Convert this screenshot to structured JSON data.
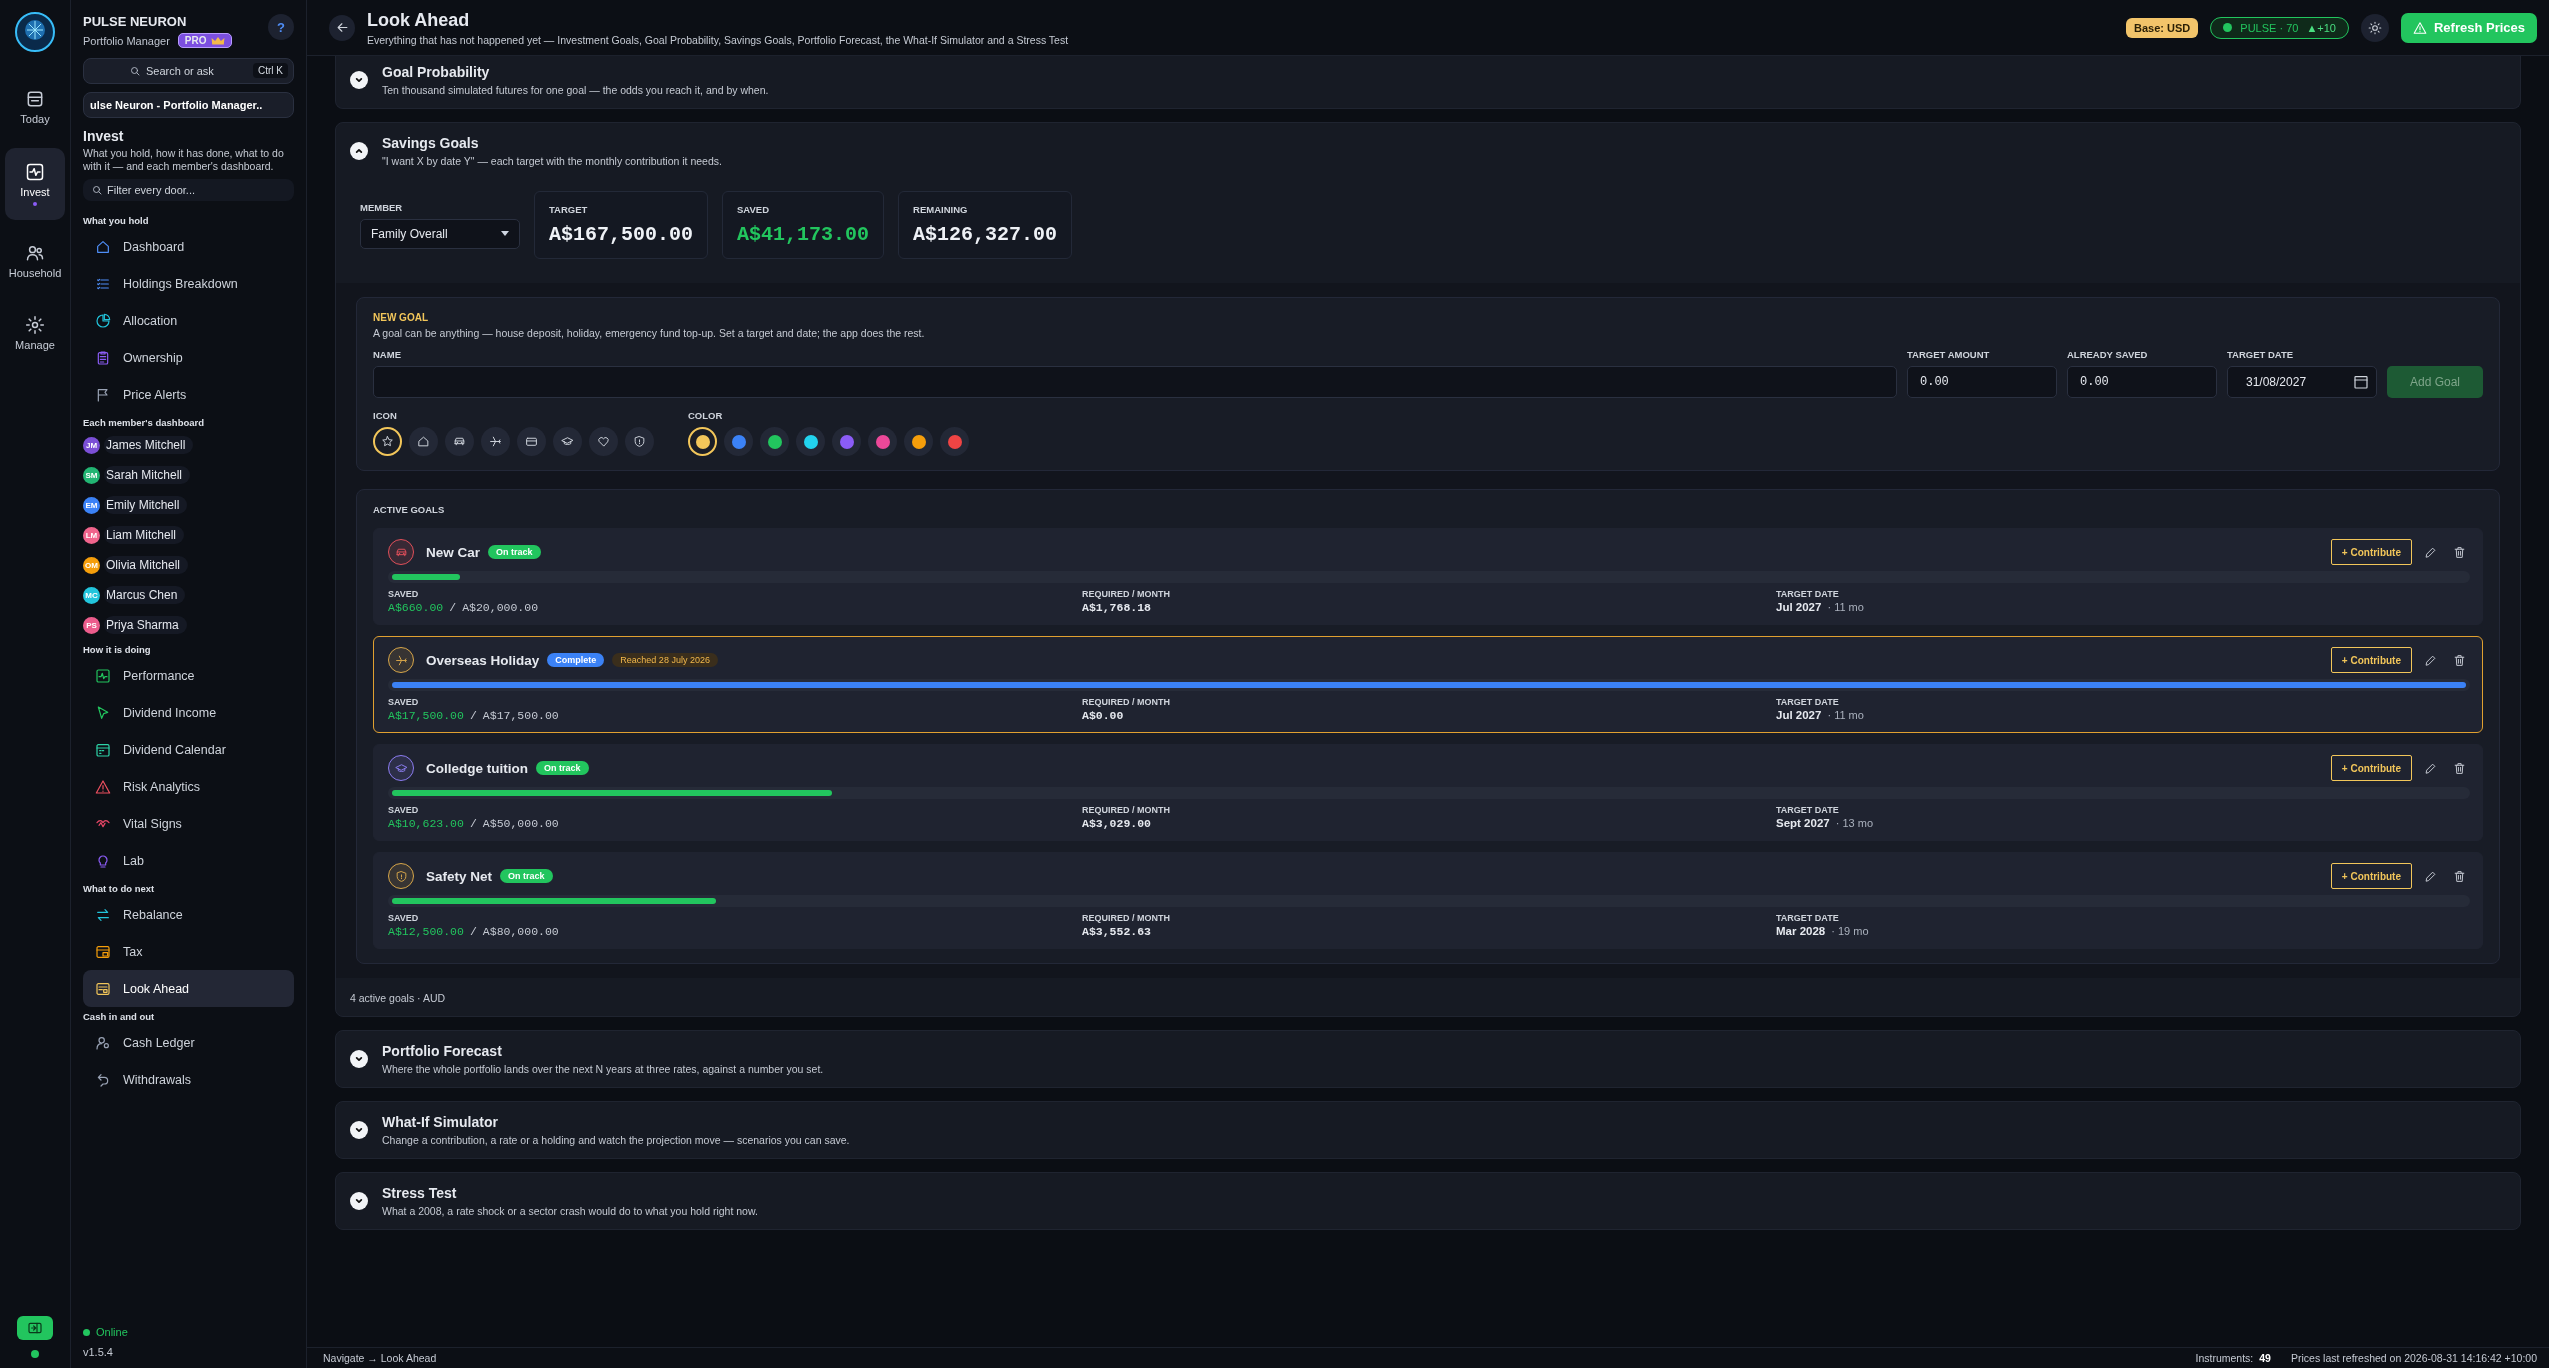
{
  "app": {
    "name": "PULSE NEURON",
    "subtitle": "Portfolio Manager",
    "badge": "PRO",
    "help": "?"
  },
  "rail": [
    {
      "label": "Today",
      "selected": false
    },
    {
      "label": "Invest",
      "selected": true
    },
    {
      "label": "Household",
      "selected": false
    },
    {
      "label": "Manage",
      "selected": false
    }
  ],
  "search": {
    "placeholder": "Search or ask",
    "shortcut": "Ctrl K"
  },
  "workspace": "ulse Neuron - Portfolio Manager..",
  "area": {
    "title": "Invest",
    "description": "What you hold, how it has done, what to do with it — and each member's dashboard."
  },
  "filter": {
    "placeholder": "Filter every door..."
  },
  "nav_groups": [
    {
      "heading": "What you hold",
      "kind": "links",
      "items": [
        {
          "label": "Dashboard",
          "selected": false
        },
        {
          "label": "Holdings Breakdown",
          "selected": false
        },
        {
          "label": "Allocation",
          "selected": false
        },
        {
          "label": "Ownership",
          "selected": false
        },
        {
          "label": "Price Alerts",
          "selected": false
        }
      ]
    },
    {
      "heading": "Each member's dashboard",
      "kind": "members",
      "items": [
        {
          "initials": "JM",
          "label": "James Mitchell",
          "color": "#7b4fd6"
        },
        {
          "initials": "SM",
          "label": "Sarah Mitchell",
          "color": "#22b573"
        },
        {
          "initials": "EM",
          "label": "Emily Mitchell",
          "color": "#3b82f6"
        },
        {
          "initials": "LM",
          "label": "Liam Mitchell",
          "color": "#f0648c"
        },
        {
          "initials": "OM",
          "label": "Olivia Mitchell",
          "color": "#f59e0b"
        },
        {
          "initials": "MC",
          "label": "Marcus Chen",
          "color": "#22c5dc"
        },
        {
          "initials": "PS",
          "label": "Priya Sharma",
          "color": "#ec5c8c"
        }
      ]
    },
    {
      "heading": "How it is doing",
      "kind": "links",
      "items": [
        {
          "label": "Performance",
          "selected": false
        },
        {
          "label": "Dividend Income",
          "selected": false
        },
        {
          "label": "Dividend Calendar",
          "selected": false
        },
        {
          "label": "Risk Analytics",
          "selected": false
        },
        {
          "label": "Vital Signs",
          "selected": false
        },
        {
          "label": "Lab",
          "selected": false
        }
      ]
    },
    {
      "heading": "What to do next",
      "kind": "links",
      "items": [
        {
          "label": "Rebalance",
          "selected": false
        },
        {
          "label": "Tax",
          "selected": false
        },
        {
          "label": "Look Ahead",
          "selected": true
        }
      ]
    },
    {
      "heading": "Cash in and out",
      "kind": "links",
      "items": [
        {
          "label": "Cash Ledger",
          "selected": false
        },
        {
          "label": "Withdrawals",
          "selected": false
        }
      ]
    }
  ],
  "connection": {
    "label": "Online",
    "online": true
  },
  "version": "v1.5.4",
  "header": {
    "title": "Look Ahead",
    "subtitle": "Everything that has not happened yet — Investment Goals, Goal Probability, Savings Goals, Portfolio Forecast, the What-If Simulator and a Stress Test",
    "base": "Base: USD",
    "pulse": "PULSE · 70",
    "pulse_change": "▲+10",
    "refresh": "Refresh Prices"
  },
  "sections": [
    {
      "title": "Goal Probability",
      "description": "Ten thousand simulated futures for one goal — the odds you reach it, and by when.",
      "expanded": false
    },
    {
      "title": "Savings Goals",
      "description": "\"I want X by date Y\" — each target with the monthly contribution it needs.",
      "expanded": true
    },
    {
      "title": "Portfolio Forecast",
      "description": "Where the whole portfolio lands over the next N years at three rates, against a number you set.",
      "expanded": false
    },
    {
      "title": "What-If Simulator",
      "description": "Change a contribution, a rate or a holding and watch the projection move — scenarios you can save.",
      "expanded": false
    },
    {
      "title": "Stress Test",
      "description": "What a 2008, a rate shock or a sector crash would do to what you hold right now.",
      "expanded": false
    }
  ],
  "savings": {
    "member": {
      "label": "MEMBER",
      "value": "Family Overall"
    },
    "stats": [
      {
        "label": "TARGET",
        "value": "A$167,500.00",
        "positive": false
      },
      {
        "label": "SAVED",
        "value": "A$41,173.00",
        "positive": true
      },
      {
        "label": "REMAINING",
        "value": "A$126,327.00",
        "positive": false
      }
    ],
    "new_goal": {
      "heading": "NEW GOAL",
      "description": "A goal can be anything — house deposit, holiday, emergency fund top-up. Set a target and date; the app does the rest.",
      "fields": [
        {
          "label": "NAME"
        },
        {
          "label": "TARGET AMOUNT",
          "value": "0.00"
        },
        {
          "label": "ALREADY SAVED",
          "value": "0.00"
        },
        {
          "label": "TARGET DATE",
          "value": "31/08/2027"
        }
      ],
      "add": {
        "label": "Add Goal",
        "disabled": true
      },
      "icon_label": "ICON",
      "icons": [
        {
          "selected": true
        },
        {
          "selected": false
        },
        {
          "selected": false
        },
        {
          "selected": false
        },
        {
          "selected": false
        },
        {
          "selected": false
        },
        {
          "selected": false
        },
        {
          "selected": false
        }
      ],
      "color_label": "COLOR",
      "colors": [
        {
          "color": "#f2c65a",
          "selected": true
        },
        {
          "color": "#3b82f6",
          "selected": false
        },
        {
          "color": "#22c55e",
          "selected": false
        },
        {
          "color": "#22d3ee",
          "selected": false
        },
        {
          "color": "#8b5cf6",
          "selected": false
        },
        {
          "color": "#ec4899",
          "selected": false
        },
        {
          "color": "#f59e0b",
          "selected": false
        },
        {
          "color": "#ef4444",
          "selected": false
        }
      ]
    },
    "active_heading": "ACTIVE GOALS",
    "goals": [
      {
        "name": "New Car",
        "color": "#e0505a",
        "status": {
          "label": "On track",
          "kind": "on_track"
        },
        "saved_label": "SAVED",
        "saved": "A$660.00",
        "sep": "/",
        "target": "A$20,000.00",
        "level": 0.033,
        "required_label": "REQUIRED / MONTH",
        "required": "A$1,768.18",
        "date_label": "TARGET DATE",
        "date": "Jul 2027",
        "remaining": "· 11 mo",
        "contribute": "+ Contribute"
      },
      {
        "name": "Overseas Holiday",
        "color": "#d7a64a",
        "status": {
          "label": "Complete",
          "kind": "complete"
        },
        "reached": "Reached 28 July 2026",
        "saved_label": "SAVED",
        "saved": "A$17,500.00",
        "sep": "/",
        "target": "A$17,500.00",
        "level": 1,
        "required_label": "REQUIRED / MONTH",
        "required": "A$0.00",
        "date_label": "TARGET DATE",
        "date": "Jul 2027",
        "remaining": "· 11 mo",
        "contribute": "+ Contribute"
      },
      {
        "name": "Colledge tuition",
        "color": "#8b7cf0",
        "status": {
          "label": "On track",
          "kind": "on_track"
        },
        "saved_label": "SAVED",
        "saved": "A$10,623.00",
        "sep": "/",
        "target": "A$50,000.00",
        "level": 0.212,
        "required_label": "REQUIRED / MONTH",
        "required": "A$3,029.00",
        "date_label": "TARGET DATE",
        "date": "Sept 2027",
        "remaining": "· 13 mo",
        "contribute": "+ Contribute"
      },
      {
        "name": "Safety Net",
        "color": "#d7a64a",
        "status": {
          "label": "On track",
          "kind": "on_track"
        },
        "saved_label": "SAVED",
        "saved": "A$12,500.00",
        "sep": "/",
        "target": "A$80,000.00",
        "level": 0.156,
        "required_label": "REQUIRED / MONTH",
        "required": "A$3,552.63",
        "date_label": "TARGET DATE",
        "date": "Mar 2028",
        "remaining": "· 19 mo",
        "contribute": "+ Contribute"
      }
    ],
    "footer": "4 active goals · AUD"
  },
  "status_bar": {
    "breadcrumb": "Navigate → Look Ahead",
    "instruments_label": "Instruments:",
    "instruments": "49",
    "refreshed": "Prices last refreshed on 2026-08-31 14:16:42 +10:00"
  }
}
